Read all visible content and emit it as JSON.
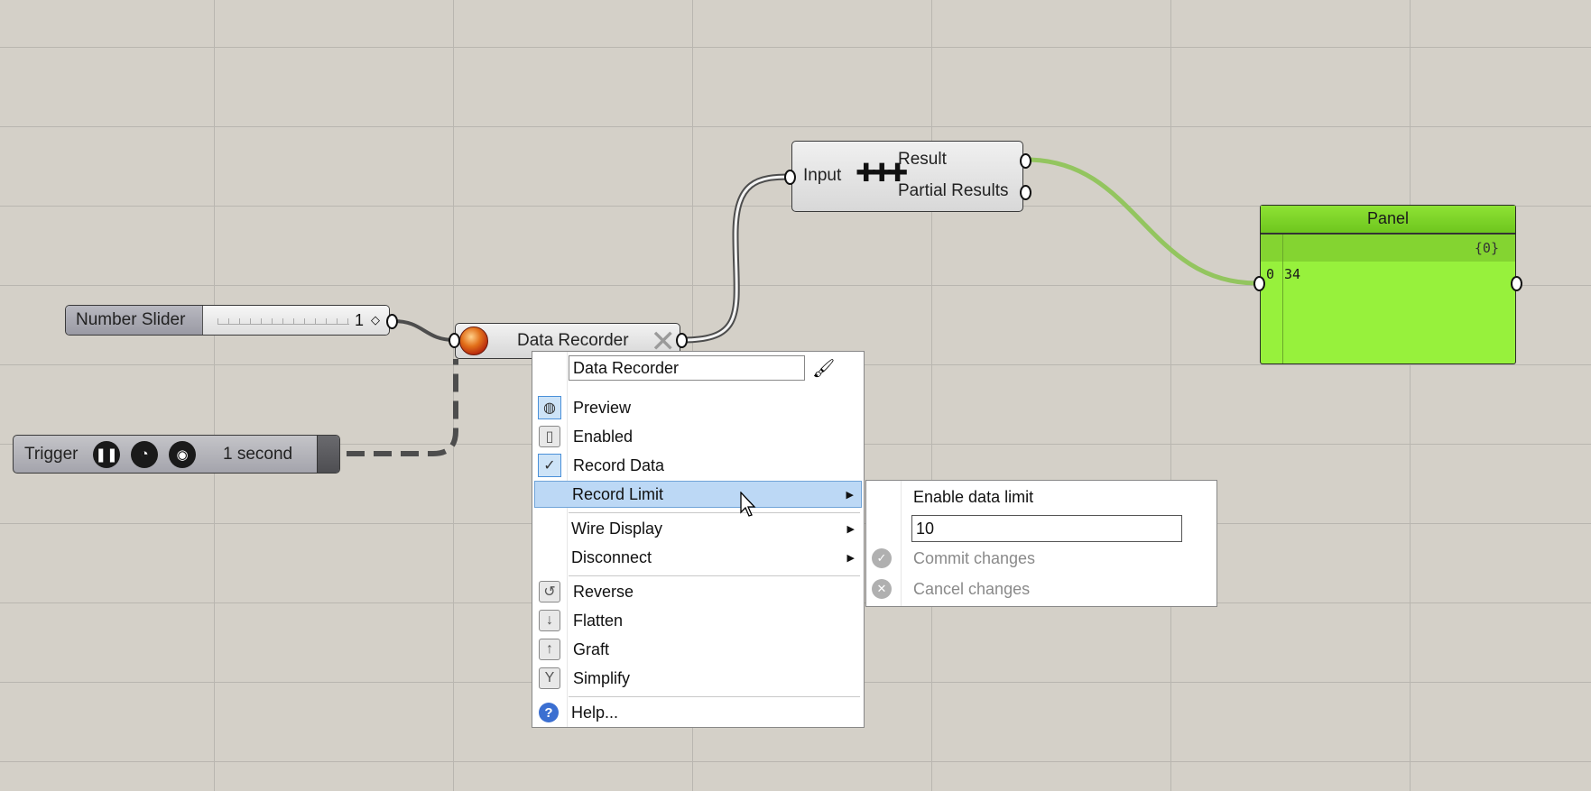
{
  "canvas": {
    "background": "#d4d0c8",
    "wire_selected_color": "#4d4d4d",
    "wire_data_color": "#8fc45a"
  },
  "number_slider": {
    "name": "Number Slider",
    "value": "1",
    "grip_icon": "diamond-icon"
  },
  "trigger": {
    "name": "Trigger",
    "interval": "1 second",
    "buttons": [
      "pause-icon",
      "timer-icon",
      "record-icon"
    ]
  },
  "data_recorder": {
    "name": "Data Recorder",
    "status_icon": "record-led-icon",
    "close_icon": "close-icon"
  },
  "mass_addition": {
    "input_label": "Input",
    "output_1": "Result",
    "output_2": "Partial Results",
    "icon": "mass-addition-icon"
  },
  "panel": {
    "title": "Panel",
    "path": "{0}",
    "rows": [
      {
        "index": "0",
        "value": "34"
      }
    ],
    "color": "#97f13c"
  },
  "context_menu": {
    "name_field": "Data Recorder",
    "items": {
      "preview": "Preview",
      "enabled": "Enabled",
      "record_data": "Record Data",
      "record_limit": "Record Limit",
      "wire_display": "Wire Display",
      "disconnect": "Disconnect",
      "reverse": "Reverse",
      "flatten": "Flatten",
      "graft": "Graft",
      "simplify": "Simplify",
      "help": "Help..."
    },
    "highlight_color": "#bcd8f5"
  },
  "record_limit_submenu": {
    "enable_label": "Enable data limit",
    "limit_value": "10",
    "commit_label": "Commit changes",
    "cancel_label": "Cancel changes"
  }
}
